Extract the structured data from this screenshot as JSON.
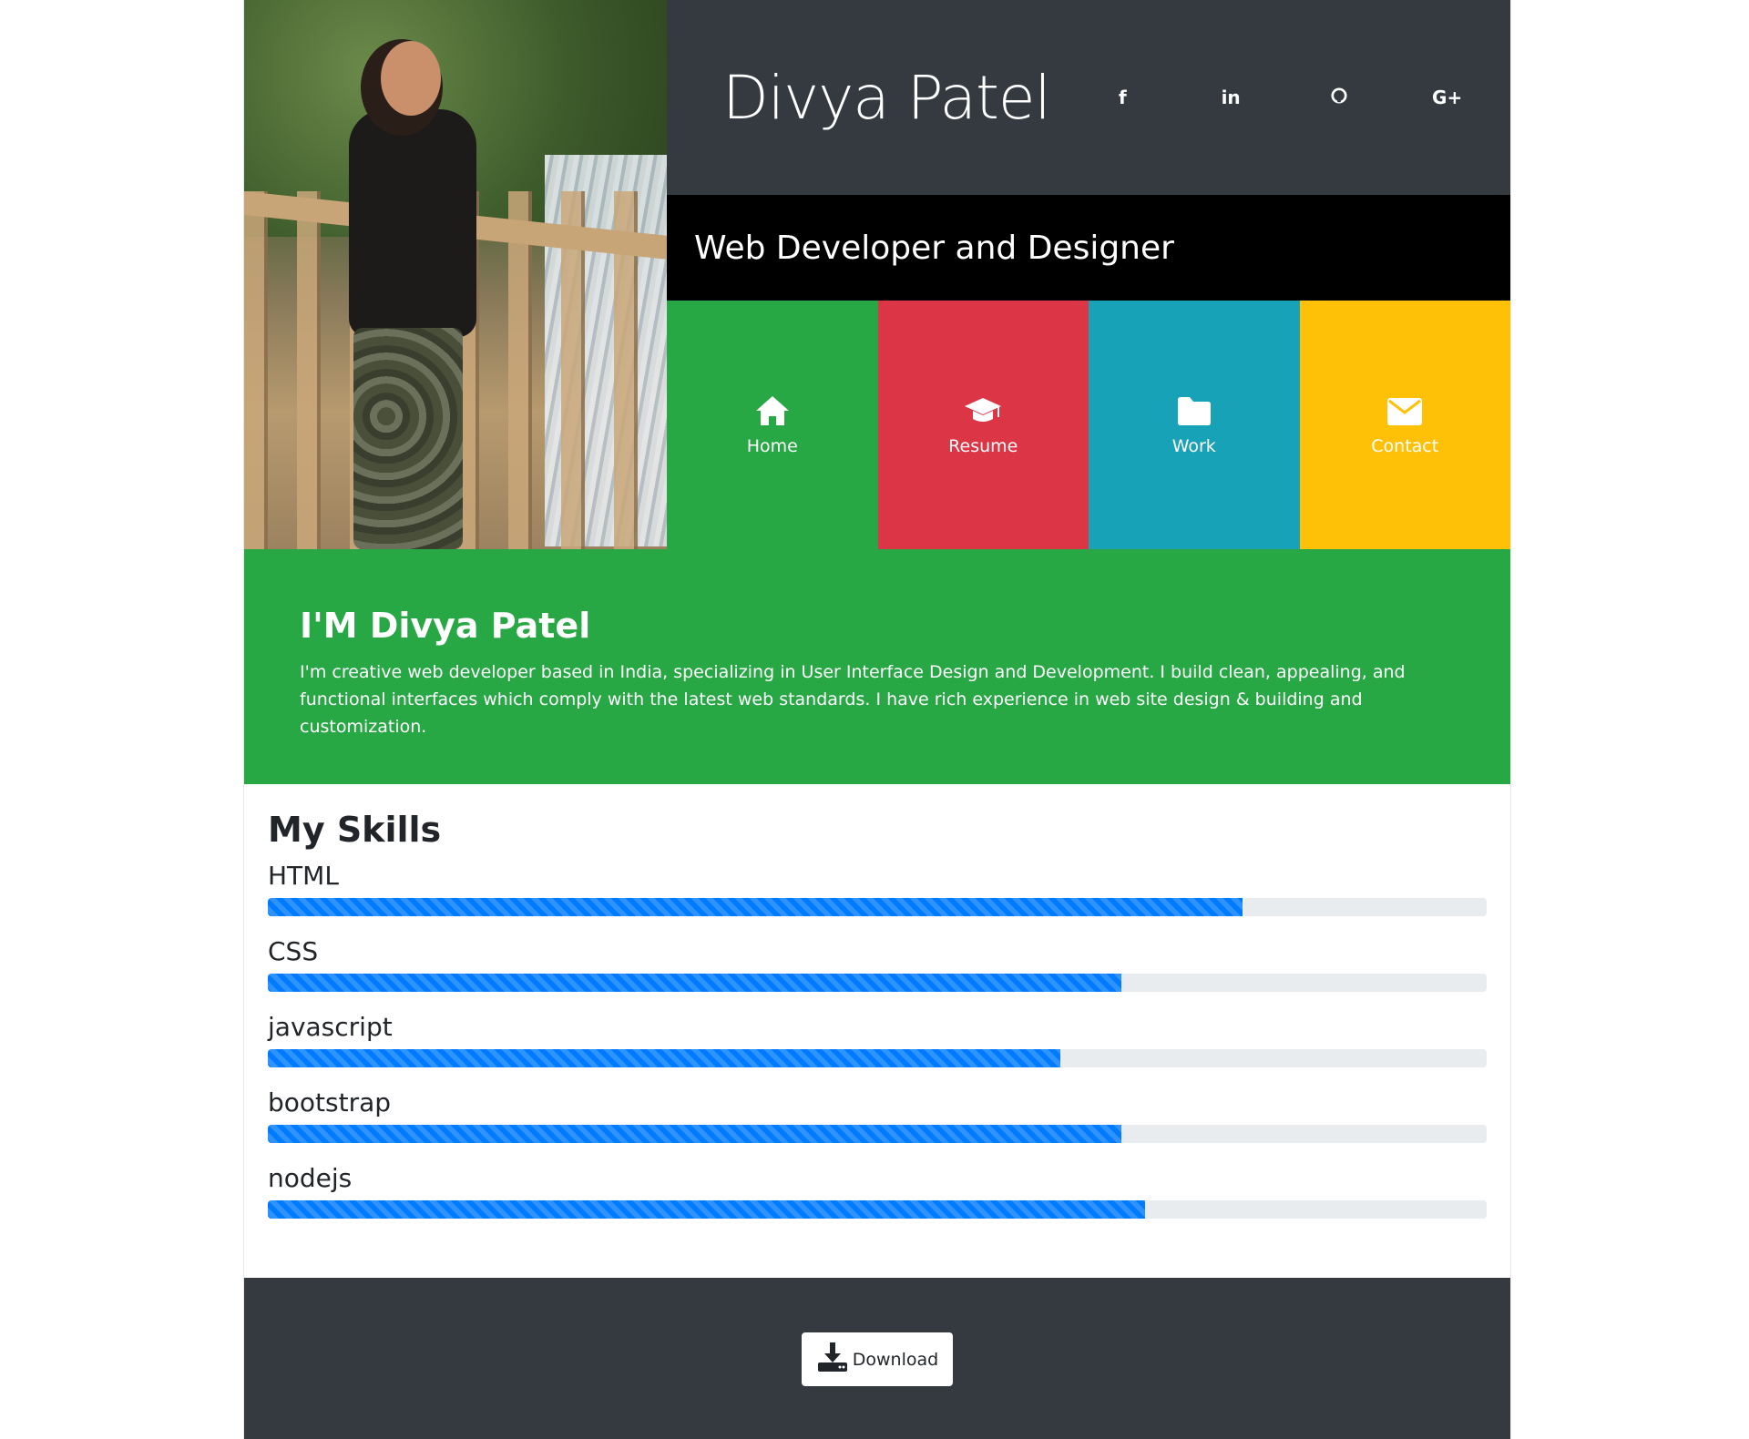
{
  "header": {
    "name": "Divya Patel",
    "subtitle": "Web Developer and Designer",
    "socials": [
      {
        "icon": "facebook-icon",
        "glyph": "f"
      },
      {
        "icon": "linkedin-icon",
        "glyph": "in"
      },
      {
        "icon": "github-icon",
        "glyph": "○"
      },
      {
        "icon": "google-plus-icon",
        "glyph": "G+"
      }
    ]
  },
  "nav": {
    "tiles": [
      {
        "label": "Home",
        "icon": "home-icon",
        "color": "#28a745"
      },
      {
        "label": "Resume",
        "icon": "graduation-cap-icon",
        "color": "#dc3545"
      },
      {
        "label": "Work",
        "icon": "folder-icon",
        "color": "#17a2b8"
      },
      {
        "label": "Contact",
        "icon": "envelope-icon",
        "color": "#ffc107"
      }
    ]
  },
  "about": {
    "title": "I'M Divya Patel",
    "text": "I'm creative web developer based in India, specializing in User Interface Design and Development. I build clean, appealing, and functional interfaces which comply with the latest web standards. I have rich experience in web site design & building and customization."
  },
  "skills": {
    "title": "My Skills",
    "items": [
      {
        "name": "HTML",
        "percent": 80
      },
      {
        "name": "CSS",
        "percent": 70
      },
      {
        "name": "javascript",
        "percent": 65
      },
      {
        "name": "bootstrap",
        "percent": 70
      },
      {
        "name": "nodejs",
        "percent": 72
      }
    ],
    "bar_color": "#007bff"
  },
  "footer": {
    "download_label": "Download"
  }
}
